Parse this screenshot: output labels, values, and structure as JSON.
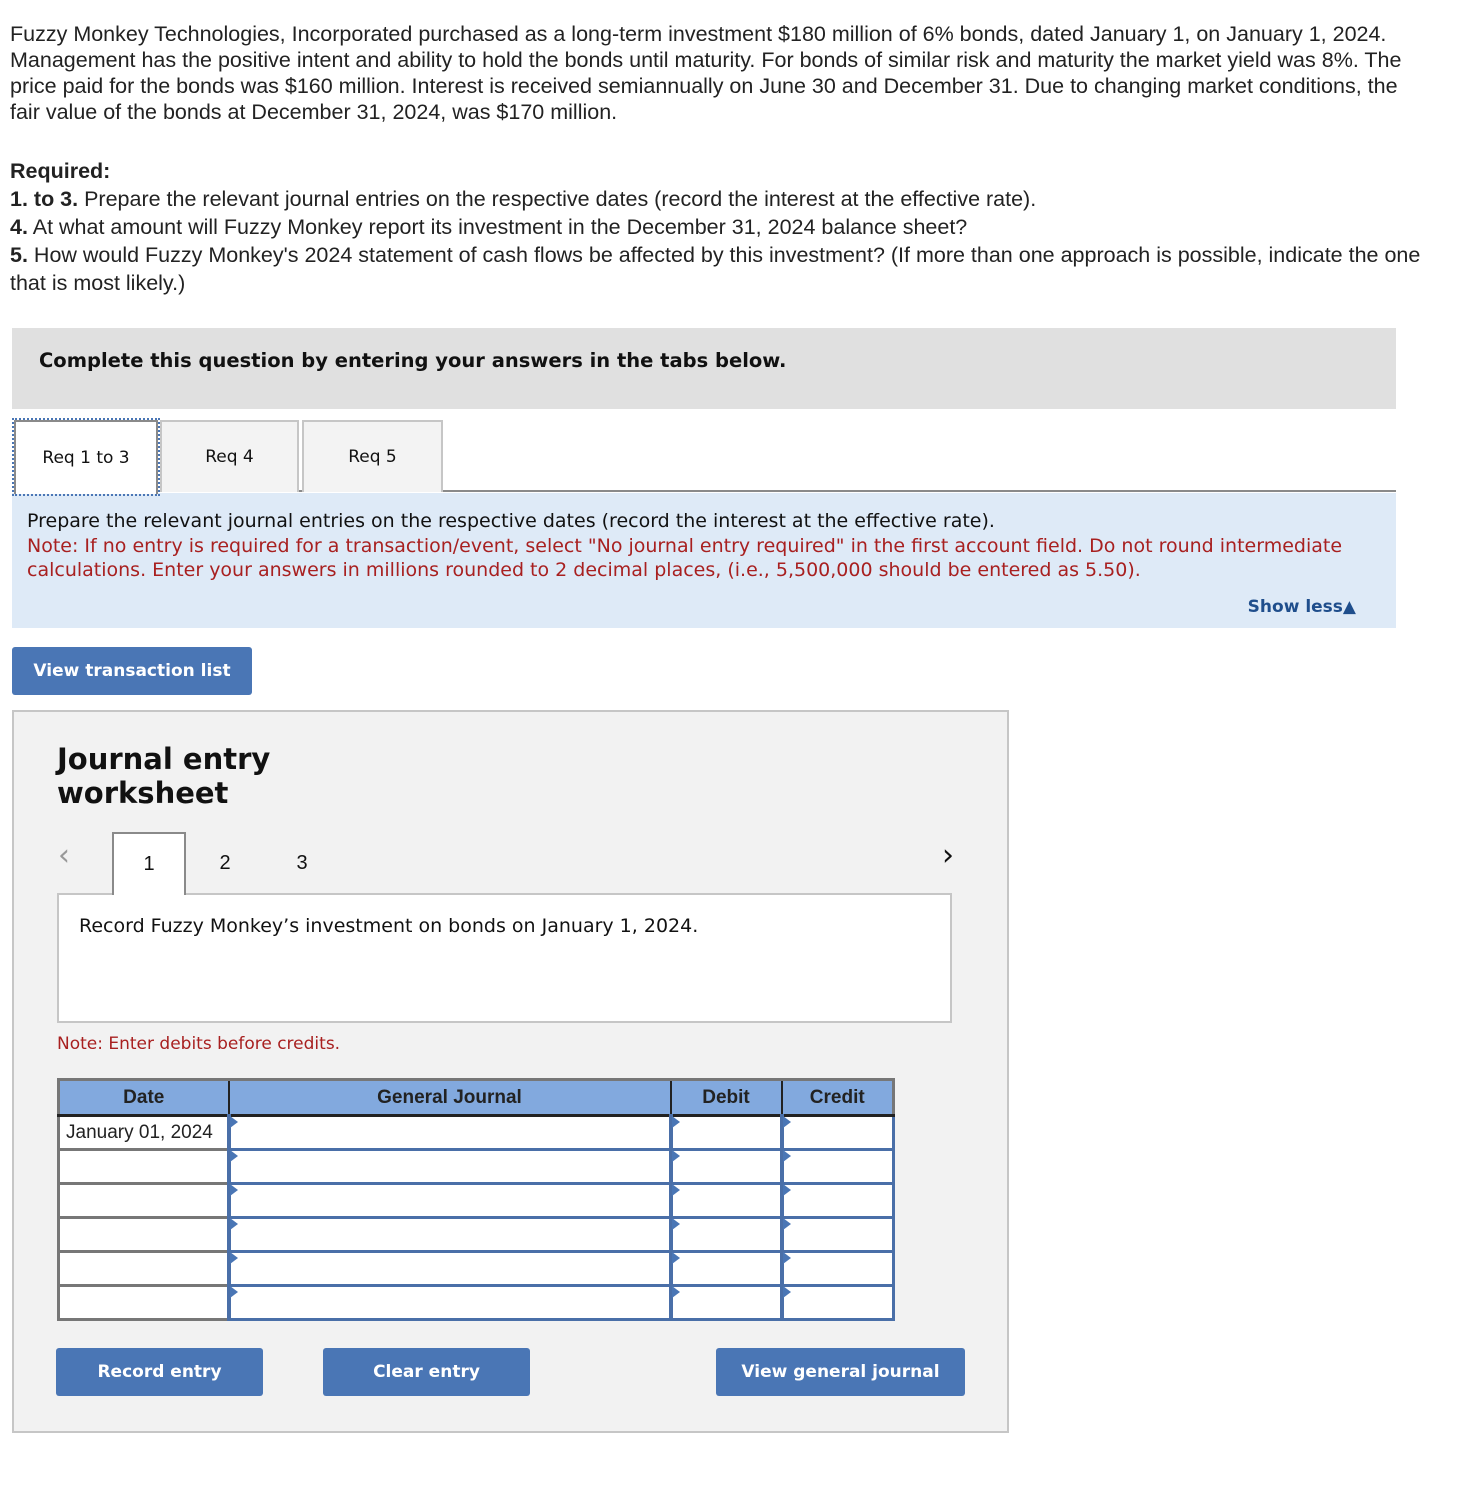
{
  "problem": {
    "text": "Fuzzy Monkey Technologies, Incorporated purchased as a long-term investment $180 million of 6% bonds, dated January 1, on January 1, 2024. Management has the positive intent and ability to hold the bonds until maturity. For bonds of similar risk and maturity the market yield was 8%. The price paid for the bonds was $160 million. Interest is received semiannually on June 30 and December 31. Due to changing market conditions, the fair value of the bonds at December 31, 2024, was $170 million."
  },
  "required": {
    "heading": "Required:",
    "items": [
      {
        "num": "1. to 3.",
        "text": " Prepare the relevant journal entries on the respective dates (record the interest at the effective rate)."
      },
      {
        "num": "4.",
        "text": " At what amount will Fuzzy Monkey report its investment in the December 31, 2024 balance sheet?"
      },
      {
        "num": "5.",
        "text": " How would Fuzzy Monkey's 2024 statement of cash flows be affected by this investment? (If more than one approach is possible, indicate the one that is most likely.)"
      }
    ]
  },
  "banner": {
    "text": "Complete this question by entering your answers in the tabs below."
  },
  "tabs": [
    {
      "label": "Req 1 to 3",
      "active": true
    },
    {
      "label": "Req 4",
      "active": false
    },
    {
      "label": "Req 5",
      "active": false
    }
  ],
  "instructions": {
    "main": "Prepare the relevant journal entries on the respective dates (record the interest at the effective rate).",
    "note": "Note: If no entry is required for a transaction/event, select \"No journal entry required\" in the first account field. Do not round intermediate calculations. Enter your answers in millions rounded to 2 decimal places, (i.e., 5,500,000 should be entered as 5.50).",
    "show_less": "Show less▲"
  },
  "view_transaction_list": "View transaction list",
  "worksheet": {
    "title_line1": "Journal entry",
    "title_line2": "worksheet",
    "prev_icon": "‹",
    "next_icon": "›",
    "pages": [
      "1",
      "2",
      "3"
    ],
    "active_page": "1",
    "description": "Record Fuzzy Monkey’s investment on bonds on January 1, 2024.",
    "debit_note": "Note: Enter debits before credits.",
    "columns": [
      "Date",
      "General Journal",
      "Debit",
      "Credit"
    ],
    "rows": [
      {
        "date": "January 01, 2024",
        "account": "",
        "debit": "",
        "credit": ""
      },
      {
        "date": "",
        "account": "",
        "debit": "",
        "credit": ""
      },
      {
        "date": "",
        "account": "",
        "debit": "",
        "credit": ""
      },
      {
        "date": "",
        "account": "",
        "debit": "",
        "credit": ""
      },
      {
        "date": "",
        "account": "",
        "debit": "",
        "credit": ""
      },
      {
        "date": "",
        "account": "",
        "debit": "",
        "credit": ""
      }
    ],
    "buttons": {
      "record": "Record entry",
      "clear": "Clear entry",
      "view_journal": "View general journal"
    }
  },
  "colors": {
    "accent_blue": "#4a76b5",
    "header_blue": "#82a9de",
    "note_red": "#a82020",
    "instruction_bg": "#deeaf7"
  }
}
